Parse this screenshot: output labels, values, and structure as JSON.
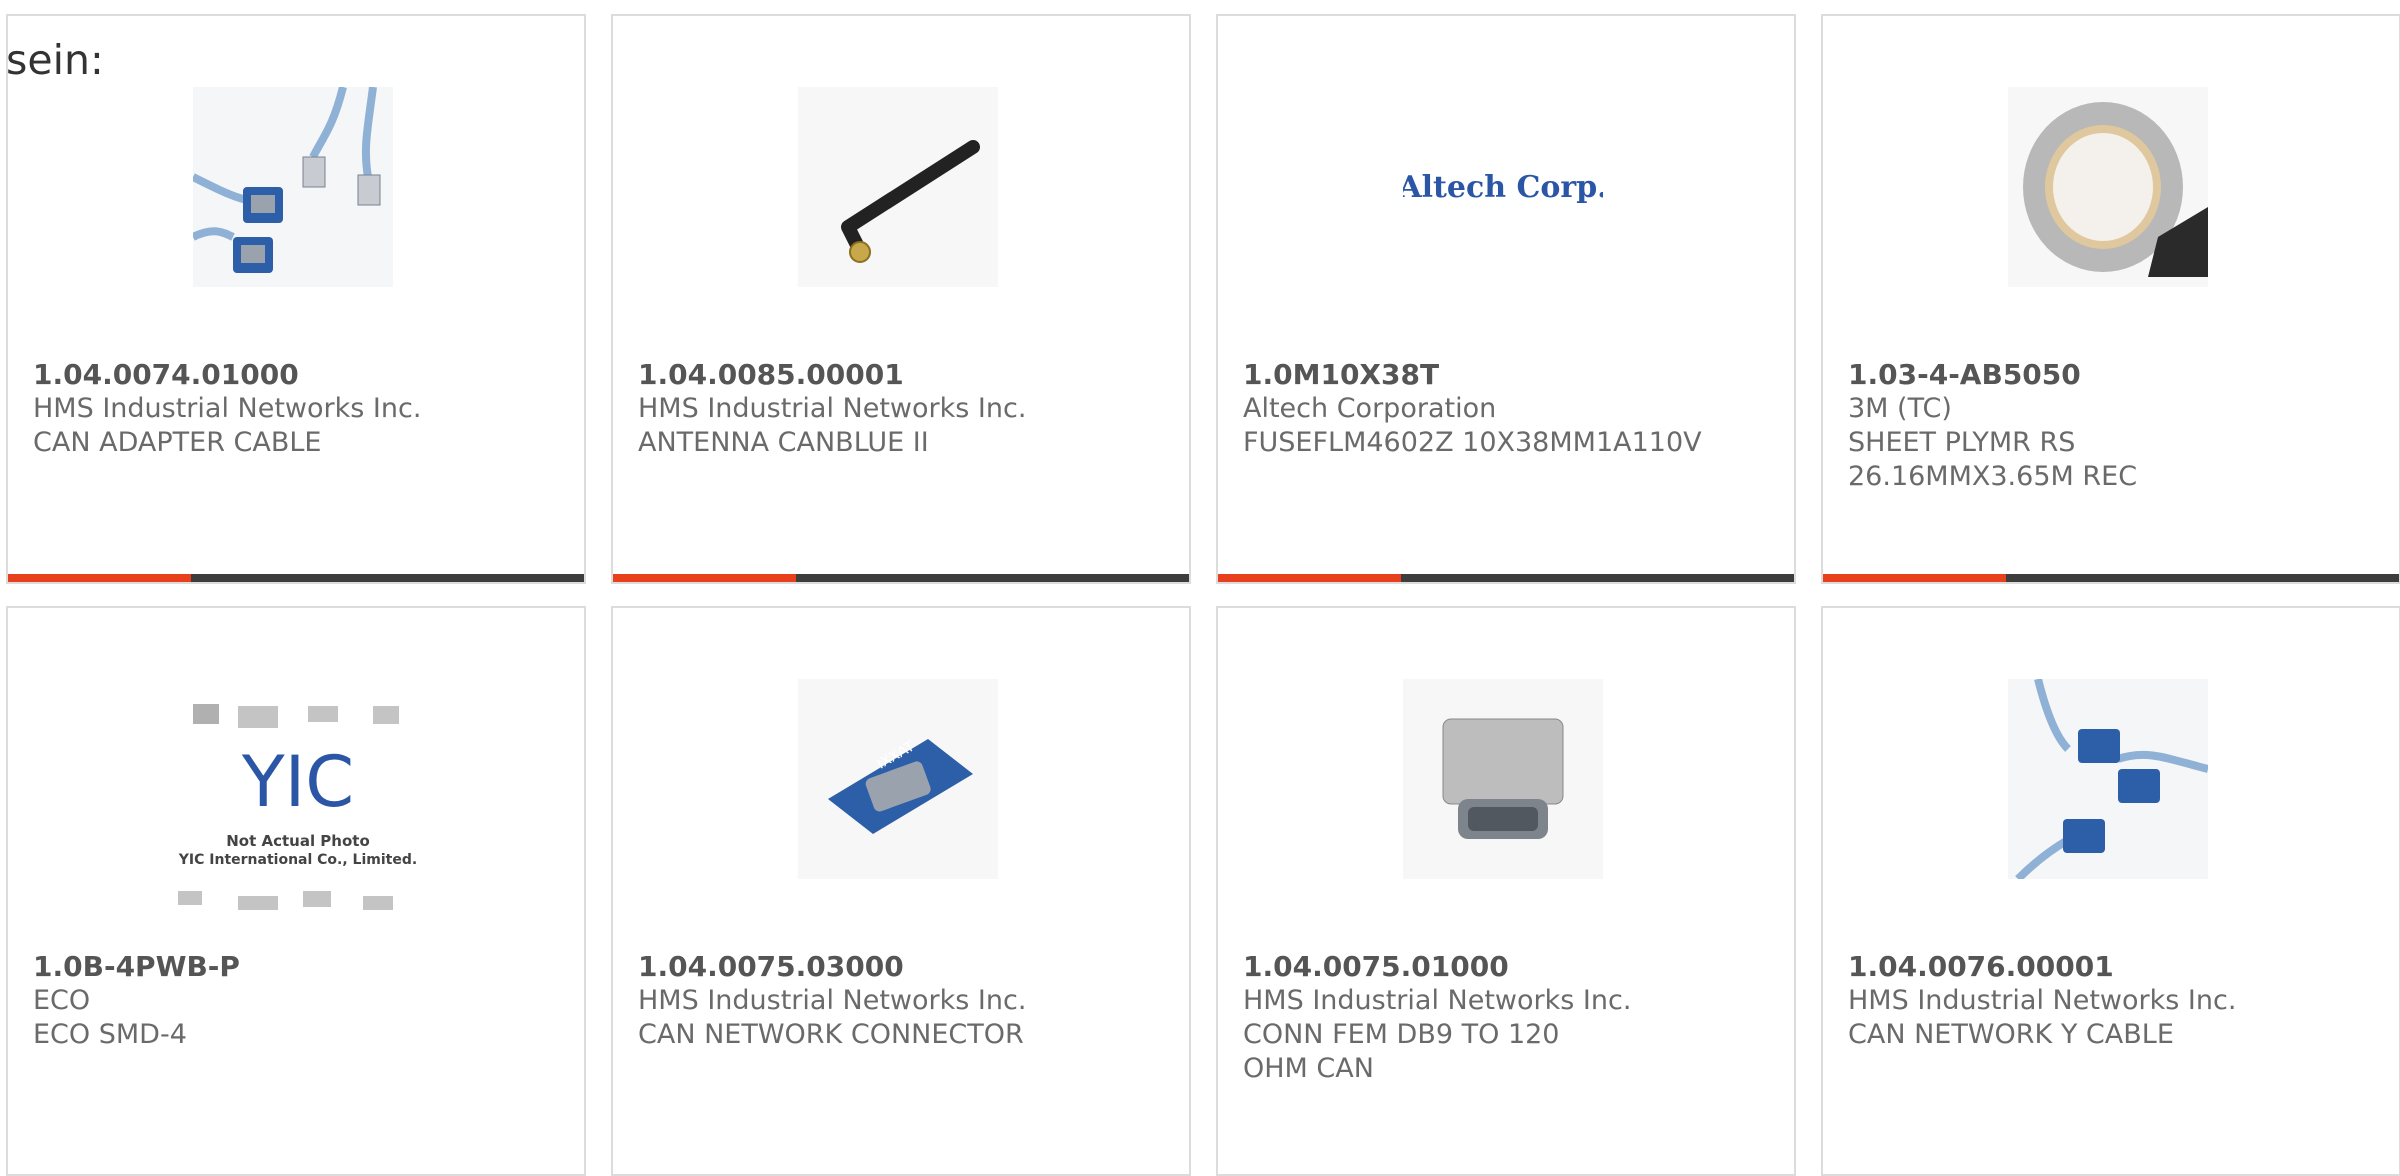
{
  "intro_text": "sein:",
  "products": [
    {
      "part_number": "1.04.0074.01000",
      "manufacturer": "HMS Industrial Networks Inc.",
      "description": "CAN ADAPTER CABLE",
      "image": "db9-cable-rj45-photo"
    },
    {
      "part_number": "1.04.0085.00001",
      "manufacturer": "HMS Industrial Networks Inc.",
      "description": "ANTENNA CANBLUE II",
      "image": "antenna-photo"
    },
    {
      "part_number": "1.0M10X38T",
      "manufacturer": "Altech Corporation",
      "description": "FUSEFLM4602Z 10X38MM1A110V",
      "image": "altech-logo",
      "logo_text": "Altech Corp."
    },
    {
      "part_number": "1.03-4-AB5050",
      "manufacturer": "3M (TC)",
      "description": "SHEET PLYMR RS 26.16MMX3.65M REC",
      "image": "tape-roll-photo"
    },
    {
      "part_number": "1.0B-4PWB-P",
      "manufacturer": "ECO",
      "description": "ECO SMD-4",
      "image": "yic-placeholder",
      "logo_text": "YIC",
      "caption_line1": "Not Actual Photo",
      "caption_line2": "YIC International Co., Limited."
    },
    {
      "part_number": "1.04.0075.03000",
      "manufacturer": "HMS Industrial Networks Inc.",
      "description": "CAN NETWORK CONNECTOR",
      "image": "db9-adapter-photo",
      "label_text": "IXXAT"
    },
    {
      "part_number": "1.04.0075.01000",
      "manufacturer": "HMS Industrial Networks Inc.",
      "description": "CONN FEM DB9 TO 120 OHM CAN",
      "image": "db9-terminator-photo"
    },
    {
      "part_number": "1.04.0076.00001",
      "manufacturer": "HMS Industrial Networks Inc.",
      "description": "CAN NETWORK Y CABLE",
      "image": "y-cable-photo"
    }
  ],
  "colors": {
    "accent": "#e8401c",
    "bar": "#3d3d3d",
    "border": "#dcdcdc",
    "text": "#6a6a6a"
  }
}
